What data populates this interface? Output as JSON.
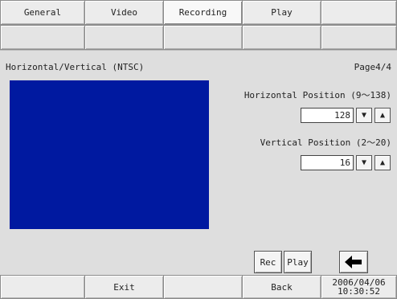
{
  "tabs": [
    {
      "label": "General"
    },
    {
      "label": "Video"
    },
    {
      "label": "Recording",
      "active": true
    },
    {
      "label": "Play"
    },
    {
      "label": ""
    }
  ],
  "panel": {
    "title": "Horizontal/Vertical (NTSC)",
    "page": "Page4/4",
    "preview_color": "#0019a0",
    "horizontal": {
      "label": "Horizontal Position (9〜138)",
      "value": "128"
    },
    "vertical": {
      "label": "Vertical Position (2〜20)",
      "value": "16"
    },
    "rec_label": "Rec",
    "play_label": "Play",
    "back_icon": "left-arrow-icon"
  },
  "footer": {
    "exit_label": "Exit",
    "back_label": "Back",
    "date": "2006/04/06",
    "time": "10:30:52"
  }
}
